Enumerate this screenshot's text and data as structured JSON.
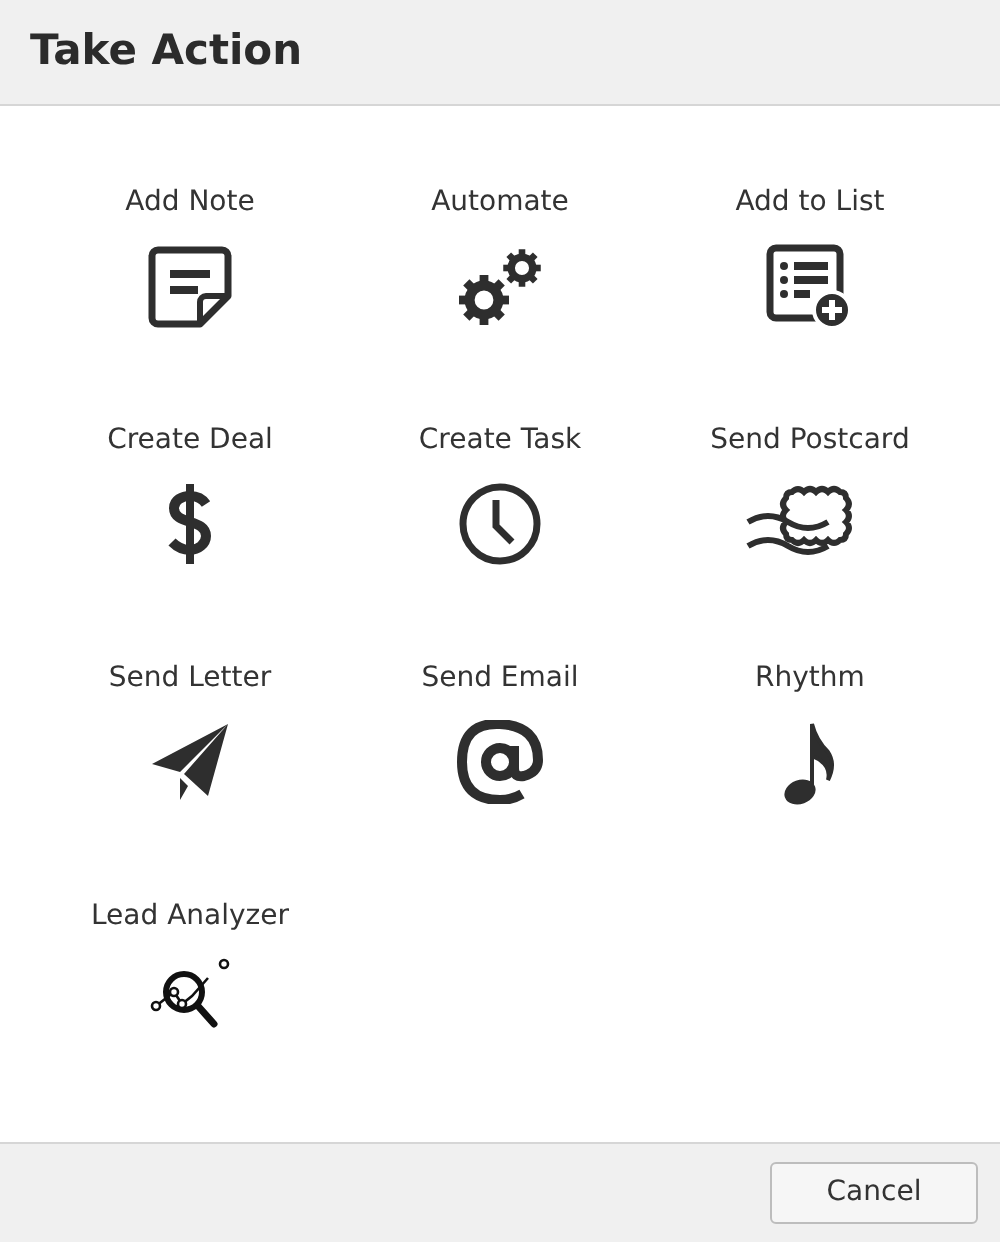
{
  "dialog": {
    "title": "Take Action"
  },
  "actions": [
    {
      "label": "Add Note",
      "kind": "note"
    },
    {
      "label": "Automate",
      "kind": "gears"
    },
    {
      "label": "Add to List",
      "kind": "list-add"
    },
    {
      "label": "Create Deal",
      "kind": "dollar"
    },
    {
      "label": "Create Task",
      "kind": "clock"
    },
    {
      "label": "Send Postcard",
      "kind": "postcard"
    },
    {
      "label": "Send Letter",
      "kind": "plane"
    },
    {
      "label": "Send Email",
      "kind": "at"
    },
    {
      "label": "Rhythm",
      "kind": "music"
    },
    {
      "label": "Lead Analyzer",
      "kind": "analyzer"
    }
  ],
  "buttons": [
    "Cancel"
  ]
}
